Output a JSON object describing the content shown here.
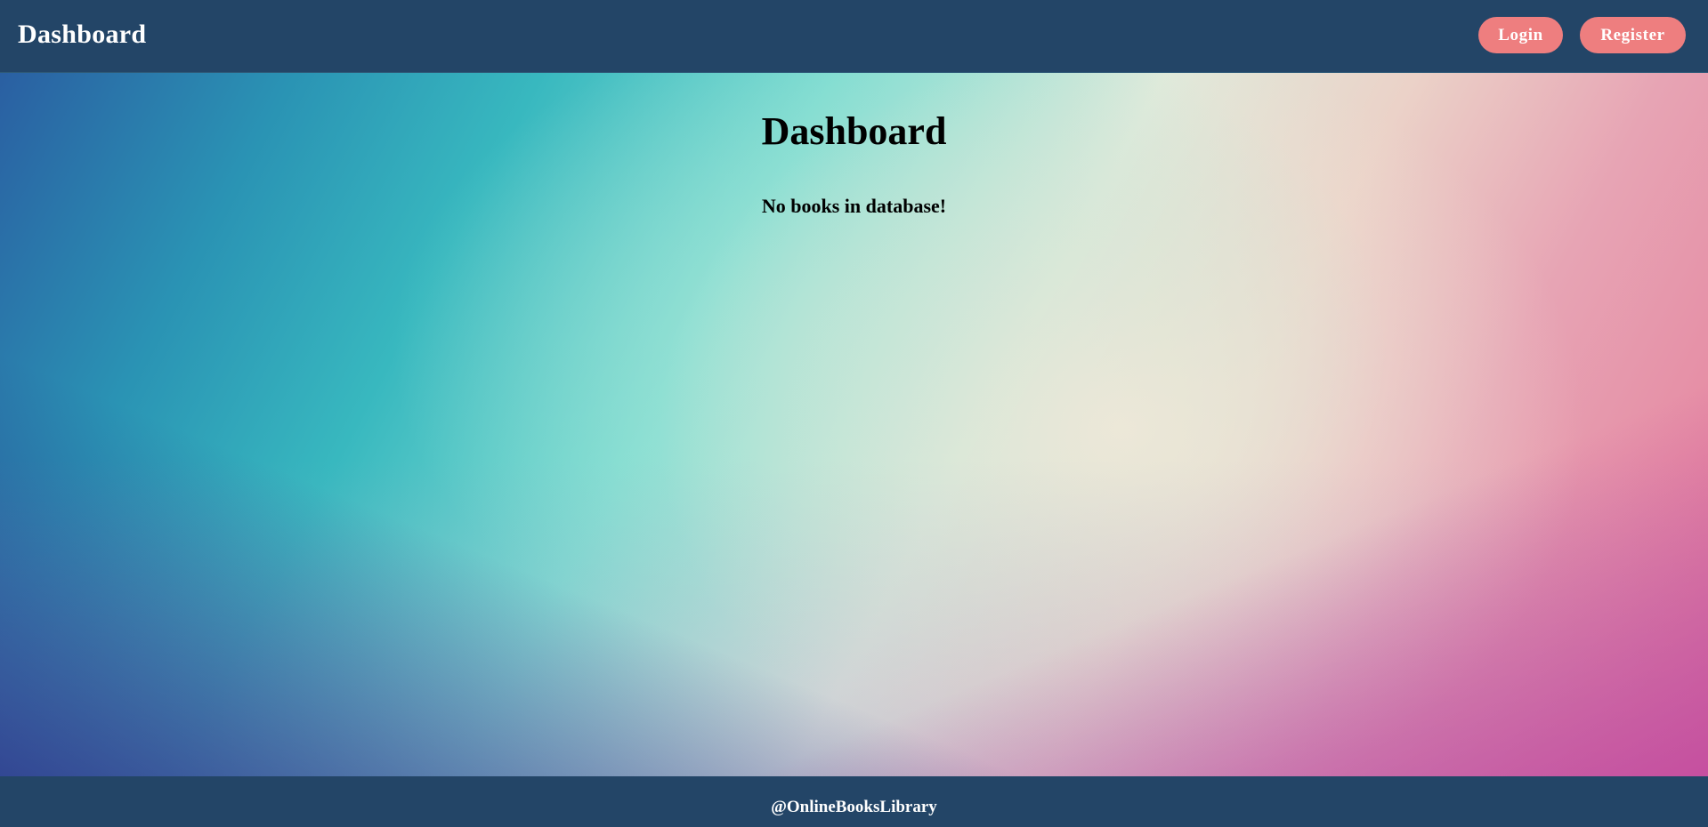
{
  "navbar": {
    "brand": "Dashboard",
    "login_label": "Login",
    "register_label": "Register"
  },
  "main": {
    "title": "Dashboard",
    "empty_message": "No books in database!"
  },
  "footer": {
    "text": "@OnlineBooksLibrary"
  },
  "colors": {
    "navbar_bg": "#234567",
    "button_bg": "#ee7e7f",
    "button_text": "#ffffff"
  }
}
